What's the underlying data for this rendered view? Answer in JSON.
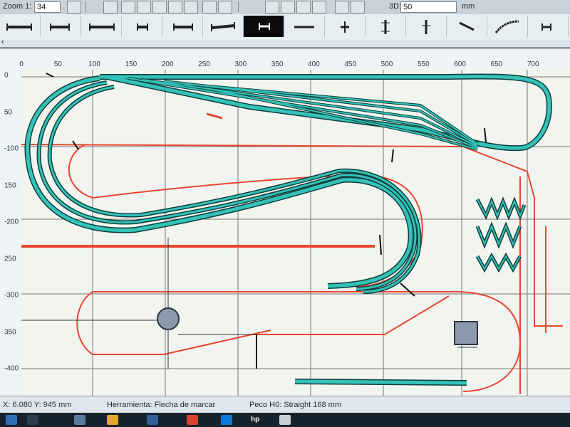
{
  "toolbar": {
    "zoom_label": "Zoom 1:",
    "zoom_value": "34",
    "three_d_label": "3D:",
    "three_d_value": "50",
    "unit": "mm"
  },
  "ruler": {
    "h_ticks": [
      "0",
      "50",
      "100",
      "150",
      "200",
      "250",
      "300",
      "350",
      "400",
      "450",
      "500",
      "550",
      "600",
      "650",
      "700"
    ],
    "v_ticks": [
      "0",
      "50",
      "-100",
      "150",
      "-200",
      "250",
      "-300",
      "350",
      "-400"
    ]
  },
  "status": {
    "coords": "X: 6.080  Y: 945 mm",
    "tool": "Herramienta: Flecha de marcar",
    "track": "Peco H0: Straight 168 mm"
  },
  "colors": {
    "track": "#33c2b8",
    "track_outline": "#0f3d3a",
    "baseboard": "#e8472f",
    "grid": "#4a4a4a",
    "selected_palette": "#0b0b0b"
  },
  "icons": {
    "scroll_left": "scroll-left-arrow-icon"
  }
}
